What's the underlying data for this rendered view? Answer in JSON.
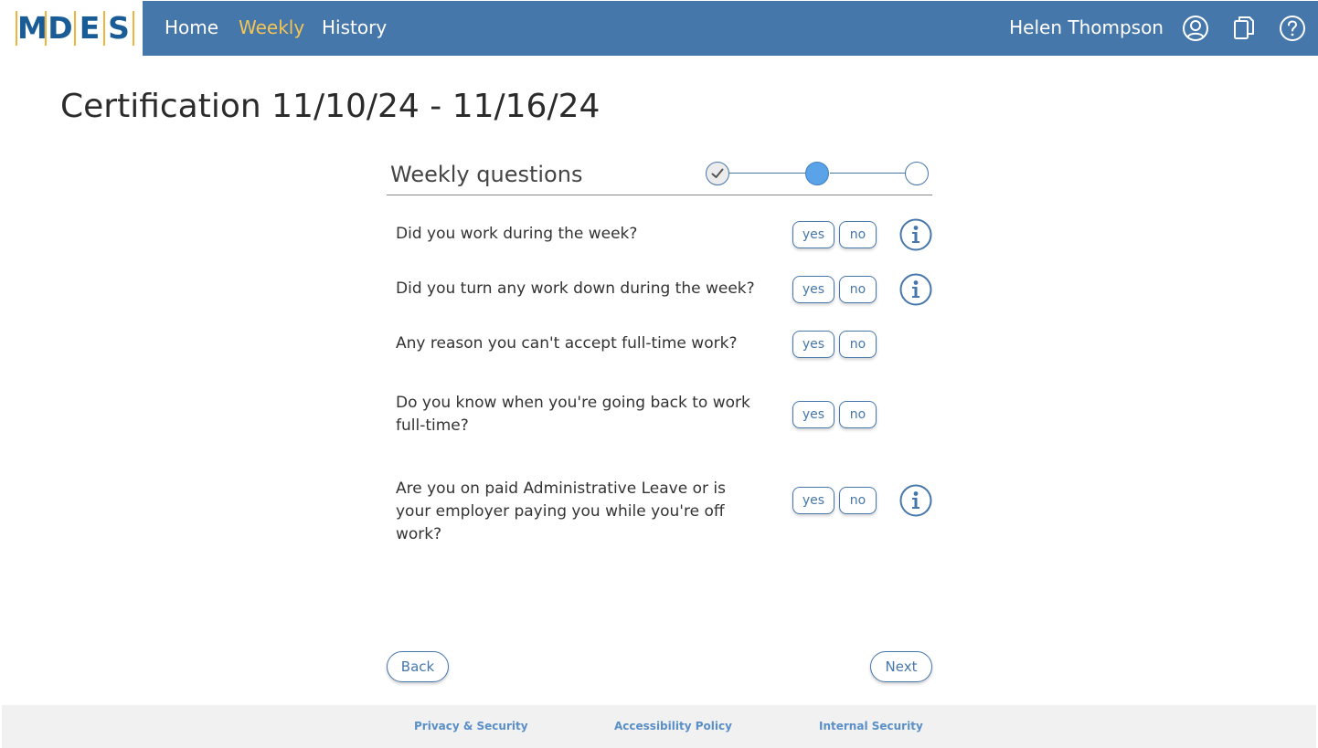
{
  "header": {
    "logo_letters": [
      "M",
      "D",
      "E",
      "S"
    ],
    "nav": [
      {
        "label": "Home",
        "active": false
      },
      {
        "label": "Weekly",
        "active": true
      },
      {
        "label": "History",
        "active": false
      }
    ],
    "user_name": "Helen Thompson",
    "icons": [
      "account-icon",
      "documents-icon",
      "help-icon"
    ]
  },
  "page": {
    "title": "Certification 11/10/24 - 11/16/24"
  },
  "section": {
    "title": "Weekly questions",
    "steps": [
      "complete",
      "current",
      "pending"
    ]
  },
  "questions": [
    {
      "text": "Did you work during the week?",
      "yes": "yes",
      "no": "no",
      "has_info": true
    },
    {
      "text": "Did you turn any work down during the week?",
      "yes": "yes",
      "no": "no",
      "has_info": true
    },
    {
      "text": "Any reason you can't accept full-time work?",
      "yes": "yes",
      "no": "no",
      "has_info": false
    },
    {
      "text": "Do you know when you're going back to work full-time?",
      "yes": "yes",
      "no": "no",
      "has_info": false
    },
    {
      "text": "Are you on paid Administrative Leave or is your employer paying you while you're off work?",
      "yes": "yes",
      "no": "no",
      "has_info": true
    }
  ],
  "buttons": {
    "back": "Back",
    "next": "Next"
  },
  "footer": {
    "links": [
      "Privacy & Security",
      "Accessibility Policy",
      "Internal Security"
    ]
  },
  "colors": {
    "primary": "#4677ab",
    "nav_active": "#f3c553",
    "step_current": "#5aa3e8",
    "logo_blue": "#1a5c96",
    "logo_gold": "#f0b43a"
  }
}
